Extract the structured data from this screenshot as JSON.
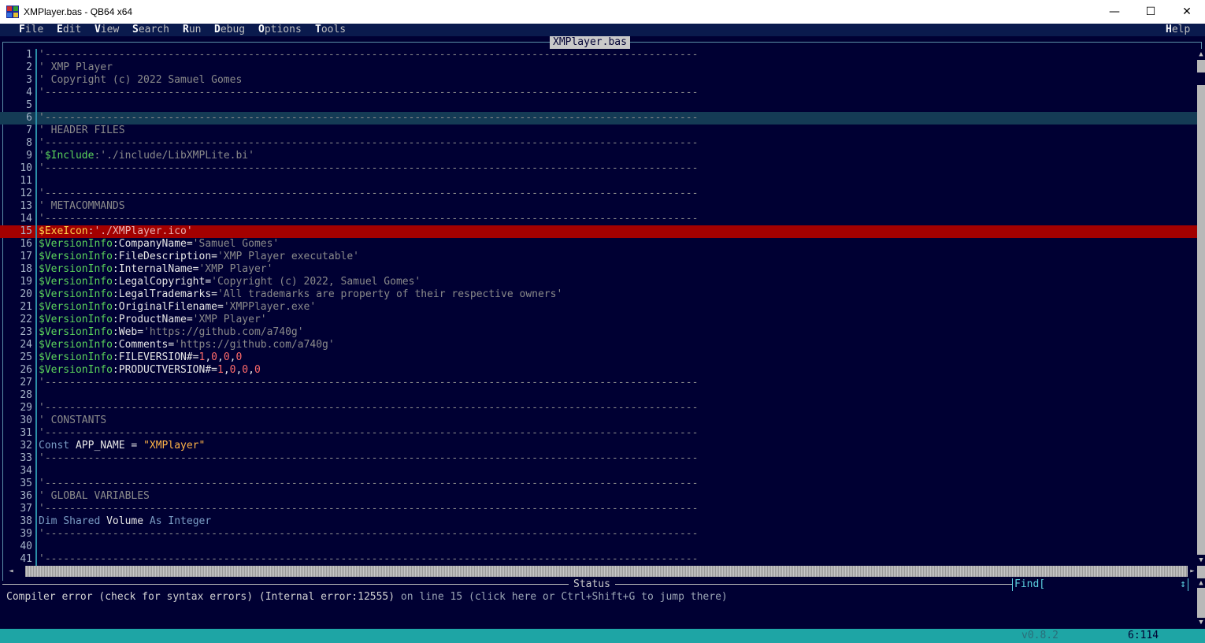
{
  "window": {
    "title": "XMPlayer.bas - QB64 x64",
    "minimize_glyph": "—",
    "maximize_glyph": "☐",
    "close_glyph": "✕"
  },
  "menu": {
    "items": [
      {
        "hotkey": "F",
        "rest": "ile"
      },
      {
        "hotkey": "E",
        "rest": "dit"
      },
      {
        "hotkey": "V",
        "rest": "iew"
      },
      {
        "hotkey": "S",
        "rest": "earch"
      },
      {
        "hotkey": "R",
        "rest": "un"
      },
      {
        "hotkey": "D",
        "rest": "ebug"
      },
      {
        "hotkey": "O",
        "rest": "ptions"
      },
      {
        "hotkey": "T",
        "rest": "ools"
      }
    ],
    "help": {
      "hotkey": "H",
      "rest": "elp"
    }
  },
  "editor": {
    "file_tab": "XMPlayer.bas",
    "current_line": 6,
    "error_line": 15,
    "lines": [
      {
        "n": "1",
        "parts": [
          {
            "t": "'----------------------------------------------------------------------------------------------------------",
            "c": "cm"
          }
        ]
      },
      {
        "n": "2",
        "parts": [
          {
            "t": "' XMP Player",
            "c": "cm"
          }
        ]
      },
      {
        "n": "3",
        "parts": [
          {
            "t": "' Copyright (c) 2022 Samuel Gomes",
            "c": "cm"
          }
        ]
      },
      {
        "n": "4",
        "parts": [
          {
            "t": "'----------------------------------------------------------------------------------------------------------",
            "c": "cm"
          }
        ]
      },
      {
        "n": "5",
        "parts": []
      },
      {
        "n": "6",
        "parts": [
          {
            "t": "'----------------------------------------------------------------------------------------------------------",
            "c": "cm"
          }
        ]
      },
      {
        "n": "7",
        "parts": [
          {
            "t": "' HEADER FILES",
            "c": "cm"
          }
        ]
      },
      {
        "n": "8",
        "parts": [
          {
            "t": "'----------------------------------------------------------------------------------------------------------",
            "c": "cm"
          }
        ]
      },
      {
        "n": "9",
        "parts": [
          {
            "t": "'",
            "c": "cm"
          },
          {
            "t": "$Include",
            "c": "meta"
          },
          {
            "t": ":'./include/LibXMPLite.bi'",
            "c": "cm"
          }
        ]
      },
      {
        "n": "10",
        "parts": [
          {
            "t": "'----------------------------------------------------------------------------------------------------------",
            "c": "cm"
          }
        ]
      },
      {
        "n": "11",
        "parts": []
      },
      {
        "n": "12",
        "parts": [
          {
            "t": "'----------------------------------------------------------------------------------------------------------",
            "c": "cm"
          }
        ]
      },
      {
        "n": "13",
        "parts": [
          {
            "t": "' METACOMMANDS",
            "c": "cm"
          }
        ]
      },
      {
        "n": "14",
        "parts": [
          {
            "t": "'----------------------------------------------------------------------------------------------------------",
            "c": "cm"
          }
        ]
      },
      {
        "n": "15",
        "parts": [
          {
            "t": "$ExeIcon",
            "c": "meta"
          },
          {
            "t": ":",
            "c": "plain"
          },
          {
            "t": "'./XMPlayer.ico'",
            "c": "cm"
          }
        ]
      },
      {
        "n": "16",
        "parts": [
          {
            "t": "$VersionInfo",
            "c": "meta"
          },
          {
            "t": ":CompanyName=",
            "c": "id"
          },
          {
            "t": "'Samuel Gomes'",
            "c": "cm"
          }
        ]
      },
      {
        "n": "17",
        "parts": [
          {
            "t": "$VersionInfo",
            "c": "meta"
          },
          {
            "t": ":FileDescription=",
            "c": "id"
          },
          {
            "t": "'XMP Player executable'",
            "c": "cm"
          }
        ]
      },
      {
        "n": "18",
        "parts": [
          {
            "t": "$VersionInfo",
            "c": "meta"
          },
          {
            "t": ":InternalName=",
            "c": "id"
          },
          {
            "t": "'XMP Player'",
            "c": "cm"
          }
        ]
      },
      {
        "n": "19",
        "parts": [
          {
            "t": "$VersionInfo",
            "c": "meta"
          },
          {
            "t": ":LegalCopyright=",
            "c": "id"
          },
          {
            "t": "'Copyright (c) 2022, Samuel Gomes'",
            "c": "cm"
          }
        ]
      },
      {
        "n": "20",
        "parts": [
          {
            "t": "$VersionInfo",
            "c": "meta"
          },
          {
            "t": ":LegalTrademarks=",
            "c": "id"
          },
          {
            "t": "'All trademarks are property of their respective owners'",
            "c": "cm"
          }
        ]
      },
      {
        "n": "21",
        "parts": [
          {
            "t": "$VersionInfo",
            "c": "meta"
          },
          {
            "t": ":OriginalFilename=",
            "c": "id"
          },
          {
            "t": "'XMPPlayer.exe'",
            "c": "cm"
          }
        ]
      },
      {
        "n": "22",
        "parts": [
          {
            "t": "$VersionInfo",
            "c": "meta"
          },
          {
            "t": ":ProductName=",
            "c": "id"
          },
          {
            "t": "'XMP Player'",
            "c": "cm"
          }
        ]
      },
      {
        "n": "23",
        "parts": [
          {
            "t": "$VersionInfo",
            "c": "meta"
          },
          {
            "t": ":Web=",
            "c": "id"
          },
          {
            "t": "'https://github.com/a740g'",
            "c": "cm"
          }
        ]
      },
      {
        "n": "24",
        "parts": [
          {
            "t": "$VersionInfo",
            "c": "meta"
          },
          {
            "t": ":Comments=",
            "c": "id"
          },
          {
            "t": "'https://github.com/a740g'",
            "c": "cm"
          }
        ]
      },
      {
        "n": "25",
        "parts": [
          {
            "t": "$VersionInfo",
            "c": "meta"
          },
          {
            "t": ":FILEVERSION#=",
            "c": "id"
          },
          {
            "t": "1",
            "c": "num"
          },
          {
            "t": ",",
            "c": "id"
          },
          {
            "t": "0",
            "c": "num"
          },
          {
            "t": ",",
            "c": "id"
          },
          {
            "t": "0",
            "c": "num"
          },
          {
            "t": ",",
            "c": "id"
          },
          {
            "t": "0",
            "c": "num"
          }
        ]
      },
      {
        "n": "26",
        "parts": [
          {
            "t": "$VersionInfo",
            "c": "meta"
          },
          {
            "t": ":PRODUCTVERSION#=",
            "c": "id"
          },
          {
            "t": "1",
            "c": "num"
          },
          {
            "t": ",",
            "c": "id"
          },
          {
            "t": "0",
            "c": "num"
          },
          {
            "t": ",",
            "c": "id"
          },
          {
            "t": "0",
            "c": "num"
          },
          {
            "t": ",",
            "c": "id"
          },
          {
            "t": "0",
            "c": "num"
          }
        ]
      },
      {
        "n": "27",
        "parts": [
          {
            "t": "'----------------------------------------------------------------------------------------------------------",
            "c": "cm"
          }
        ]
      },
      {
        "n": "28",
        "parts": []
      },
      {
        "n": "29",
        "parts": [
          {
            "t": "'----------------------------------------------------------------------------------------------------------",
            "c": "cm"
          }
        ]
      },
      {
        "n": "30",
        "parts": [
          {
            "t": "' CONSTANTS",
            "c": "cm"
          }
        ]
      },
      {
        "n": "31",
        "parts": [
          {
            "t": "'----------------------------------------------------------------------------------------------------------",
            "c": "cm"
          }
        ]
      },
      {
        "n": "32",
        "parts": [
          {
            "t": "Const",
            "c": "kw"
          },
          {
            "t": " APP_NAME = ",
            "c": "id"
          },
          {
            "t": "\"XMPlayer\"",
            "c": "str"
          }
        ]
      },
      {
        "n": "33",
        "parts": [
          {
            "t": "'----------------------------------------------------------------------------------------------------------",
            "c": "cm"
          }
        ]
      },
      {
        "n": "34",
        "parts": []
      },
      {
        "n": "35",
        "parts": [
          {
            "t": "'----------------------------------------------------------------------------------------------------------",
            "c": "cm"
          }
        ]
      },
      {
        "n": "36",
        "parts": [
          {
            "t": "' GLOBAL VARIABLES",
            "c": "cm"
          }
        ]
      },
      {
        "n": "37",
        "parts": [
          {
            "t": "'----------------------------------------------------------------------------------------------------------",
            "c": "cm"
          }
        ]
      },
      {
        "n": "38",
        "parts": [
          {
            "t": "Dim Shared",
            "c": "kw"
          },
          {
            "t": " Volume ",
            "c": "id"
          },
          {
            "t": "As Integer",
            "c": "kw"
          }
        ]
      },
      {
        "n": "39",
        "parts": [
          {
            "t": "'----------------------------------------------------------------------------------------------------------",
            "c": "cm"
          }
        ]
      },
      {
        "n": "40",
        "parts": []
      },
      {
        "n": "41",
        "parts": [
          {
            "t": "'----------------------------------------------------------------------------------------------------------",
            "c": "cm"
          }
        ]
      }
    ]
  },
  "scroll": {
    "up": "▲",
    "down": "▼",
    "left": "◄",
    "right": "►"
  },
  "status": {
    "label": "Status",
    "find_label": "Find[",
    "find_arrow": "↕",
    "message_main": "Compiler error (check for syntax errors) (Internal error:12555)",
    "message_tail": " on line 15 (click here or Ctrl+Shift+G to jump there)"
  },
  "bottom": {
    "version": "v0.8.2",
    "cursor_pos": "6:114"
  },
  "colors": {
    "background": "#000033",
    "error_line": "#a30000",
    "current_line": "#143b55",
    "bottom_bar": "#1ea5a5"
  }
}
